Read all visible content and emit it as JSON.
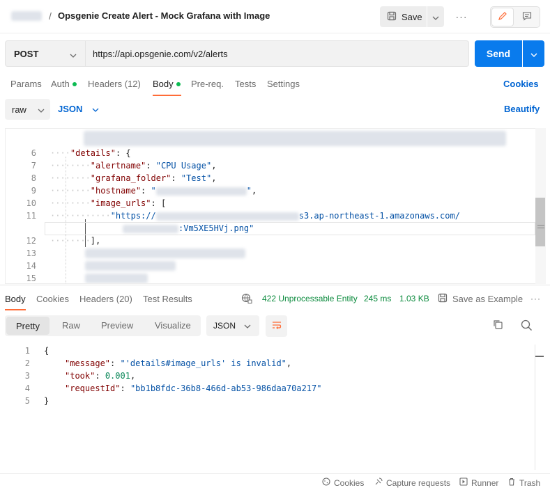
{
  "header": {
    "separator": "/",
    "request_title": "Opsgenie Create Alert - Mock Grafana with Image",
    "save_label": "Save",
    "more_label": "···"
  },
  "url_bar": {
    "method": "POST",
    "url": "https://api.opsgenie.com/v2/alerts",
    "send_label": "Send"
  },
  "request_tabs": {
    "params": "Params",
    "auth": "Auth",
    "headers": "Headers (12)",
    "body": "Body",
    "prereq": "Pre-req.",
    "tests": "Tests",
    "settings": "Settings",
    "cookies": "Cookies"
  },
  "body_options": {
    "mode": "raw",
    "language": "JSON",
    "beautify": "Beautify"
  },
  "editor": {
    "line_numbers": [
      "6",
      "7",
      "8",
      "9",
      "10",
      "11",
      "12",
      "13",
      "14",
      "15"
    ],
    "details_key": "\"details\"",
    "alertname_key": "\"alertname\"",
    "alertname_val": "\"CPU Usage\"",
    "folder_key": "\"grafana_folder\"",
    "folder_val": "\"Test\"",
    "hostname_key": "\"hostname\"",
    "hostname_val_open": "\"",
    "image_urls_key": "\"image_urls\"",
    "url_prefix": "\"https://",
    "url_host": "s3.ap-northeast-1.amazonaws.com/",
    "url_suffix": ":Vm5XE5HVj.png\"",
    "close_bracket": "],"
  },
  "response_tabs": {
    "body": "Body",
    "cookies": "Cookies",
    "headers": "Headers (20)",
    "test_results": "Test Results",
    "status": "422 Unprocessable Entity",
    "time": "245 ms",
    "size": "1.03 KB",
    "save_example": "Save as Example",
    "more": "···"
  },
  "response_view": {
    "pretty": "Pretty",
    "raw": "Raw",
    "preview": "Preview",
    "visualize": "Visualize",
    "format": "JSON"
  },
  "response_body": {
    "line_numbers": [
      "1",
      "2",
      "3",
      "4",
      "5"
    ],
    "open_brace": "{",
    "message_key": "\"message\"",
    "message_val": "\"'details#image_urls' is invalid\"",
    "took_key": "\"took\"",
    "took_val": "0.001",
    "request_id_key": "\"requestId\"",
    "request_id_val": "\"bb1b8fdc-36b8-466d-ab53-986daa70a217\"",
    "close_brace": "}"
  },
  "footer": {
    "cookies": "Cookies",
    "capture": "Capture requests",
    "runner": "Runner",
    "trash": "Trash"
  },
  "colors": {
    "accent_orange": "#ff6c37",
    "send_blue": "#097bed",
    "link_blue": "#0265d2",
    "status_green": "#0a8a3c"
  }
}
